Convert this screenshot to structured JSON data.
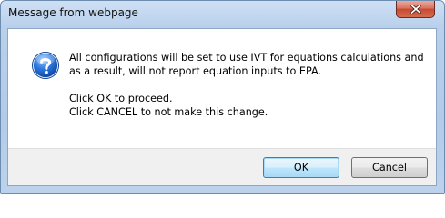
{
  "window": {
    "title": "Message from webpage",
    "close_icon": "close-icon"
  },
  "dialog": {
    "icon": "question-icon",
    "message_line1": "All configurations will be set to use IVT for equations calculations and",
    "message_line2": "as a result, will not report equation inputs to EPA.",
    "proceed_line": "Click OK to proceed.",
    "cancel_line": "Click CANCEL to not make this change."
  },
  "buttons": {
    "ok_label": "OK",
    "cancel_label": "Cancel"
  },
  "colors": {
    "titlebar": "#b9d0ec",
    "close_button": "#c74a30",
    "icon_blue": "#1d5fc4",
    "default_button_border": "#3c7fb1"
  }
}
